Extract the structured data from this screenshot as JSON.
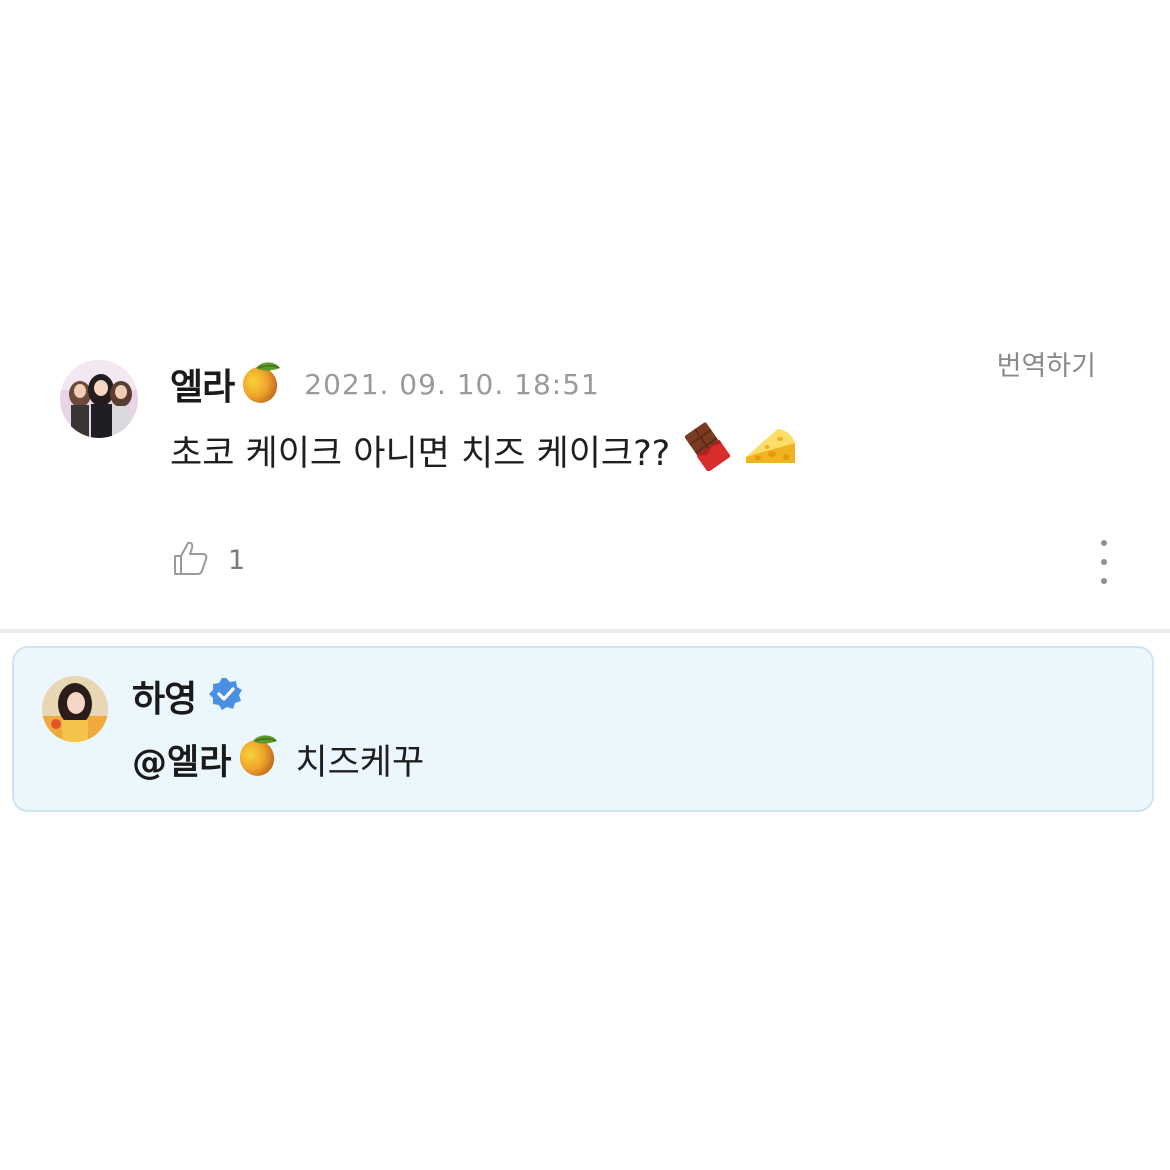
{
  "comment": {
    "author": {
      "name": "엘라",
      "avatar_icon": "avatar-photo",
      "name_emoji": "mango-icon"
    },
    "timestamp": "2021. 09. 10. 18:51",
    "translate_label": "번역하기",
    "text": "초코 케이크 아니면 치즈 케이크??",
    "text_emojis": [
      "chocolate-icon",
      "cheese-icon"
    ],
    "like_count": "1",
    "like_icon": "thumbs-up-icon",
    "more_icon": "more-vertical-icon"
  },
  "reply": {
    "author": {
      "name": "하영",
      "avatar_icon": "avatar-photo",
      "badge_icon": "verified-icon"
    },
    "mention": "@엘라",
    "mention_emoji": "mango-icon",
    "text": "치즈케꾸"
  },
  "colors": {
    "reply_background": "#ecf7fd",
    "reply_border": "#cfe4f0",
    "verified_badge": "#4a90e2",
    "timestamp": "#9a9a9a"
  }
}
